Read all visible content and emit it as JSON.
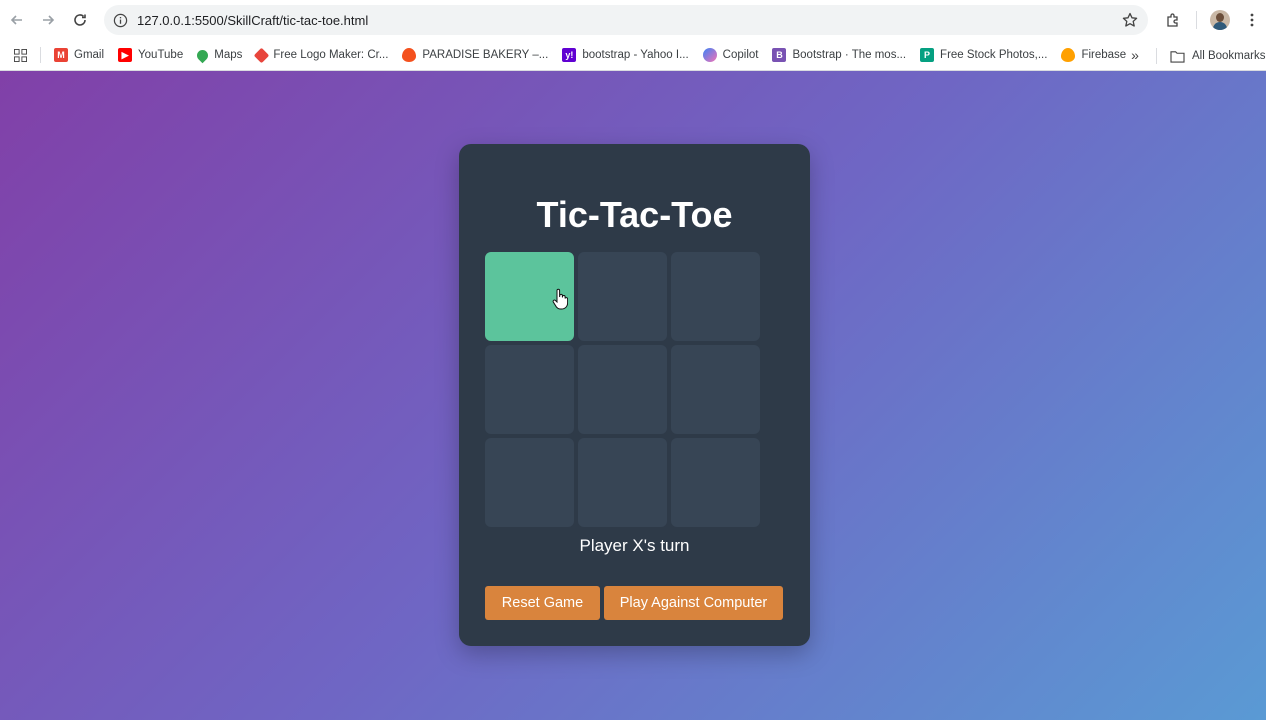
{
  "browser": {
    "url": "127.0.0.1:5500/SkillCraft/tic-tac-toe.html",
    "bookmarks": [
      {
        "label": "Gmail",
        "icon": "gmail-icon",
        "color": "#ea4335"
      },
      {
        "label": "YouTube",
        "icon": "youtube-icon",
        "color": "#ff0000"
      },
      {
        "label": "Maps",
        "icon": "maps-icon",
        "color": "#34a853"
      },
      {
        "label": "Free Logo Maker: Cr...",
        "icon": "logo-maker-icon",
        "color": "#e8453c"
      },
      {
        "label": "PARADISE BAKERY –...",
        "icon": "flame-icon",
        "color": "#f4511e"
      },
      {
        "label": "bootstrap - Yahoo I...",
        "icon": "yahoo-icon",
        "color": "#6001d2"
      },
      {
        "label": "Copilot",
        "icon": "copilot-icon",
        "color": "#3b82f6"
      },
      {
        "label": "Bootstrap · The mos...",
        "icon": "bootstrap-icon",
        "color": "#7952b3"
      },
      {
        "label": "Free Stock Photos,...",
        "icon": "stock-photos-icon",
        "color": "#05a081"
      },
      {
        "label": "Firebase",
        "icon": "firebase-icon",
        "color": "#ffa000"
      }
    ],
    "all_bookmarks_label": "All Bookmarks"
  },
  "game": {
    "title": "Tic-Tac-Toe",
    "cells": [
      "",
      "",
      "",
      "",
      "",
      "",
      "",
      "",
      ""
    ],
    "hover_cell_index": 0,
    "status": "Player X's turn",
    "reset_label": "Reset Game",
    "computer_label": "Play Against Computer"
  },
  "colors": {
    "card": "#2e3a48",
    "cell": "#374555",
    "cell_hover": "#5cc49c",
    "button": "#d9843d"
  }
}
